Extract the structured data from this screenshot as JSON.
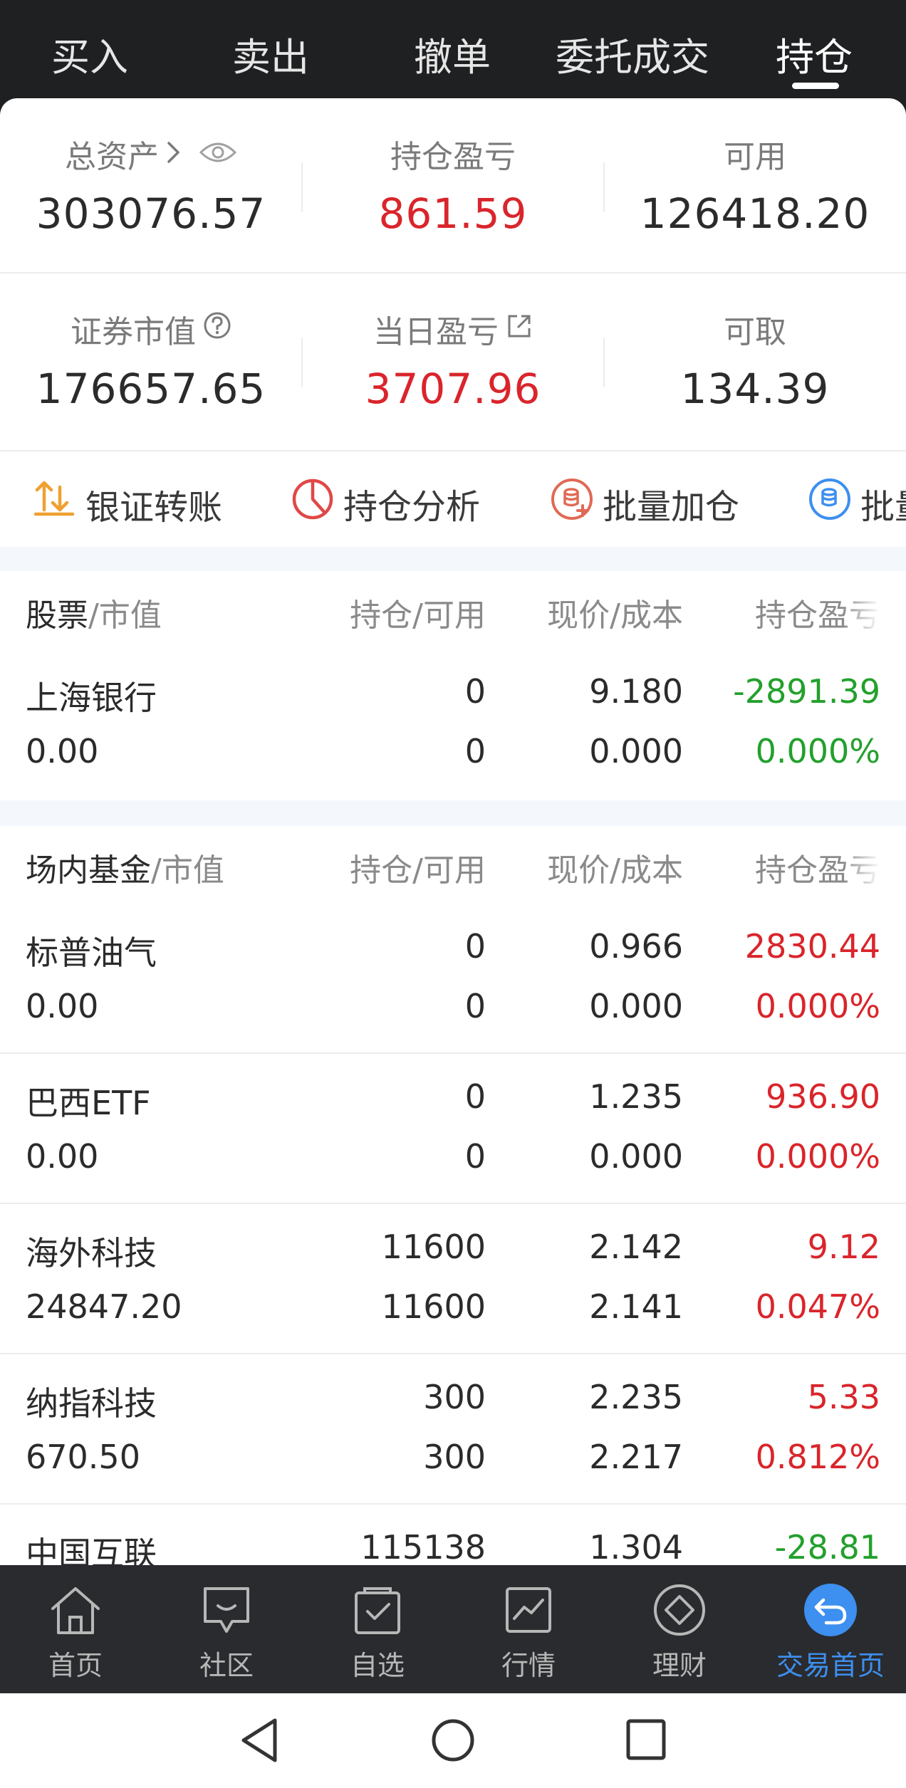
{
  "top_tabs": [
    "买入",
    "卖出",
    "撤单",
    "委托成交",
    "持仓"
  ],
  "summary": {
    "total_assets_label": "总资产",
    "total_assets": "303076.57",
    "position_pnl_label": "持仓盈亏",
    "position_pnl": "861.59",
    "available_label": "可用",
    "available": "126418.20",
    "market_value_label": "证券市值",
    "market_value": "176657.65",
    "daily_pnl_label": "当日盈亏",
    "daily_pnl": "3707.96",
    "withdrawable_label": "可取",
    "withdrawable": "134.39"
  },
  "actions": [
    "银证转账",
    "持仓分析",
    "批量加仓",
    "批量"
  ],
  "stock_section": {
    "header": {
      "name": "股票",
      "name_suffix": "/市值",
      "qty": "持仓/可用",
      "price": "现价/成本",
      "pnl": "持仓盈亏"
    },
    "rows": [
      {
        "name": "上海银行",
        "value": "0.00",
        "position": "0",
        "available": "0",
        "price": "9.180",
        "cost": "0.000",
        "pnl": "-2891.39",
        "pnl_pct": "0.000%",
        "color": "#23a02c"
      }
    ]
  },
  "fund_section": {
    "header": {
      "name": "场内基金",
      "name_suffix": "/市值",
      "qty": "持仓/可用",
      "price": "现价/成本",
      "pnl": "持仓盈亏"
    },
    "rows": [
      {
        "name": "标普油气",
        "value": "0.00",
        "position": "0",
        "available": "0",
        "price": "0.966",
        "cost": "0.000",
        "pnl": "2830.44",
        "pnl_pct": "0.000%",
        "color": "#d9252b"
      },
      {
        "name": "巴西ETF",
        "value": "0.00",
        "position": "0",
        "available": "0",
        "price": "1.235",
        "cost": "0.000",
        "pnl": "936.90",
        "pnl_pct": "0.000%",
        "color": "#d9252b"
      },
      {
        "name": "海外科技",
        "value": "24847.20",
        "position": "11600",
        "available": "11600",
        "price": "2.142",
        "cost": "2.141",
        "pnl": "9.12",
        "pnl_pct": "0.047%",
        "color": "#d9252b"
      },
      {
        "name": "纳指科技",
        "value": "670.50",
        "position": "300",
        "available": "300",
        "price": "2.235",
        "cost": "2.217",
        "pnl": "5.33",
        "pnl_pct": "0.812%",
        "color": "#d9252b"
      },
      {
        "name": "中国互联",
        "position": "115138",
        "price": "1.304",
        "pnl": "-28.81",
        "color": "#23a02c"
      }
    ]
  },
  "bottom_nav": [
    "首页",
    "社区",
    "自选",
    "行情",
    "理财",
    "交易首页"
  ],
  "colors": {
    "up": "#d9252b",
    "down": "#23a02c",
    "accent": "#3d8ff0"
  }
}
